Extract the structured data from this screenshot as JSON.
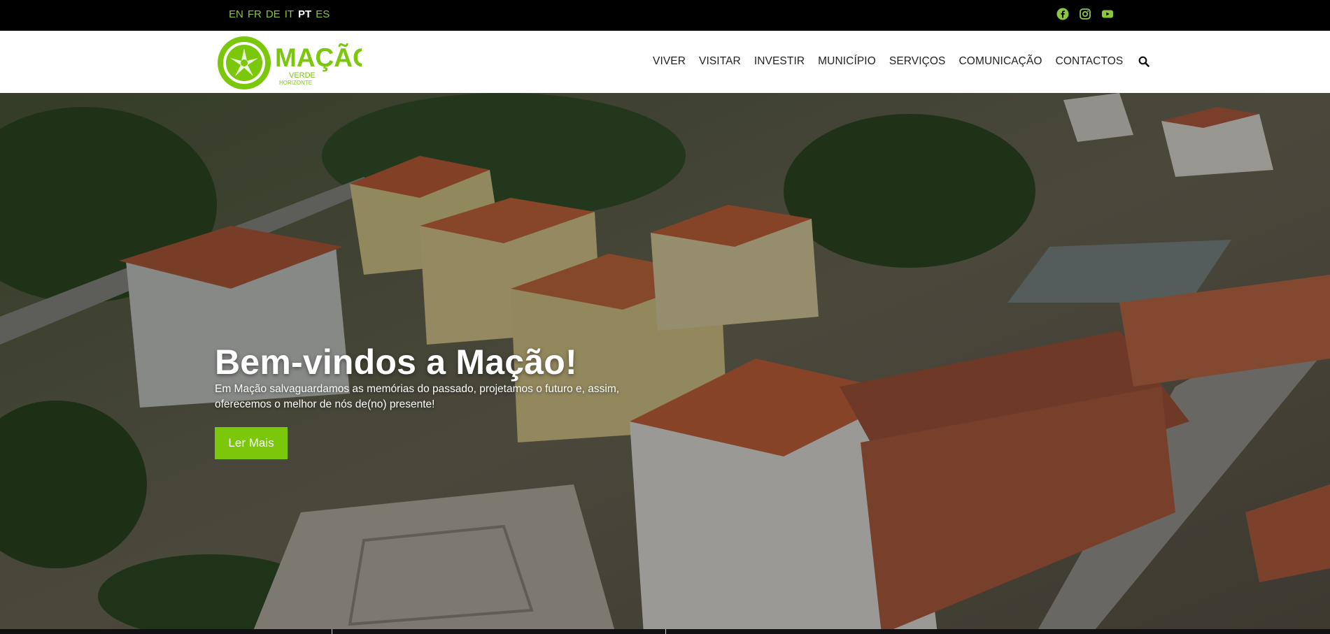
{
  "topbar": {
    "languages": [
      {
        "code": "EN",
        "active": false
      },
      {
        "code": "FR",
        "active": false
      },
      {
        "code": "DE",
        "active": false
      },
      {
        "code": "IT",
        "active": false
      },
      {
        "code": "PT",
        "active": true
      },
      {
        "code": "ES",
        "active": false
      }
    ],
    "socials": [
      "facebook-icon",
      "instagram-icon",
      "youtube-icon"
    ],
    "accent_color": "#8cc63f"
  },
  "logo": {
    "name": "MAÇÃO",
    "tagline_1": "VERDE",
    "tagline_2": "HORIZONTE",
    "color": "#7ac70c"
  },
  "nav": {
    "items": [
      "VIVER",
      "VISITAR",
      "INVESTIR",
      "MUNICÍPIO",
      "SERVIÇOS",
      "COMUNICAÇÃO",
      "CONTACTOS"
    ],
    "search_icon": "search-icon"
  },
  "hero": {
    "title": "Bem-vindos a Mação!",
    "text": "Em Mação salvaguardamos as memórias do passado, projetamos o futuro e, assim, oferecemos o melhor de nós de(no) presente!",
    "button_label": "Ler Mais",
    "button_color": "#7ac70c"
  }
}
